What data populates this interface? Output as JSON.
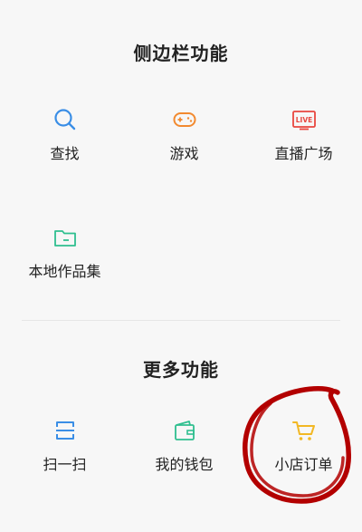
{
  "sidebar_section": {
    "title": "侧边栏功能",
    "items": [
      {
        "label": "查找",
        "icon": "search-icon",
        "color": "#3a8ee6"
      },
      {
        "label": "游戏",
        "icon": "gamepad-icon",
        "color": "#f28a30"
      },
      {
        "label": "直播广场",
        "icon": "live-icon",
        "color": "#e8473f",
        "icon_text": "LIVE"
      },
      {
        "label": "本地作品集",
        "icon": "folder-icon",
        "color": "#2fbf8f"
      }
    ]
  },
  "more_section": {
    "title": "更多功能",
    "items": [
      {
        "label": "扫一扫",
        "icon": "scan-icon",
        "color": "#3a8ee6"
      },
      {
        "label": "我的钱包",
        "icon": "wallet-icon",
        "color": "#2fbf8f"
      },
      {
        "label": "小店订单",
        "icon": "cart-icon",
        "color": "#f2b824"
      }
    ]
  },
  "annotation": {
    "shape": "hand-drawn-circle",
    "color": "#b30000"
  }
}
